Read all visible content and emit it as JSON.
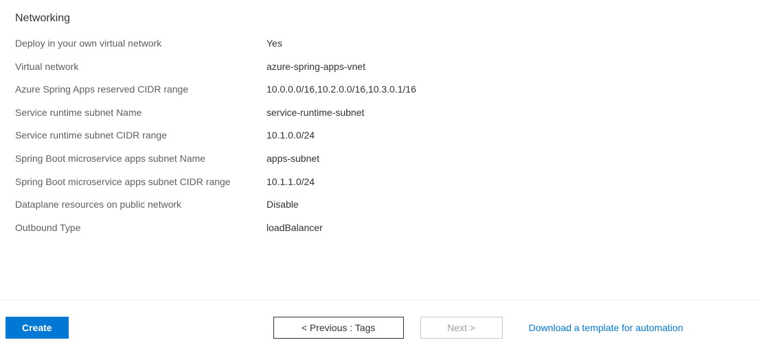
{
  "section": {
    "title": "Networking",
    "fields": [
      {
        "label": "Deploy in your own virtual network",
        "value": "Yes"
      },
      {
        "label": "Virtual network",
        "value": "azure-spring-apps-vnet"
      },
      {
        "label": "Azure Spring Apps reserved CIDR range",
        "value": "10.0.0.0/16,10.2.0.0/16,10.3.0.1/16"
      },
      {
        "label": "Service runtime subnet Name",
        "value": "service-runtime-subnet"
      },
      {
        "label": "Service runtime subnet CIDR range",
        "value": "10.1.0.0/24"
      },
      {
        "label": "Spring Boot microservice apps subnet Name",
        "value": "apps-subnet"
      },
      {
        "label": "Spring Boot microservice apps subnet CIDR range",
        "value": "10.1.1.0/24"
      },
      {
        "label": "Dataplane resources on public network",
        "value": "Disable"
      },
      {
        "label": "Outbound Type",
        "value": "loadBalancer"
      }
    ]
  },
  "footer": {
    "create": "Create",
    "previous": "< Previous : Tags",
    "next": "Next >",
    "download": "Download a template for automation"
  }
}
